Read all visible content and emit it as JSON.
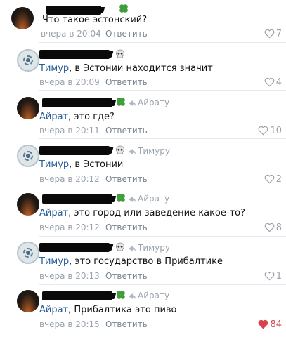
{
  "comments": [
    {
      "avatar": "sunset-avatar",
      "avatar_style": "photo",
      "name_icon": "clover-icon",
      "reply_to": "",
      "mention": "",
      "text": "Что такое эстонский?",
      "time": "вчера в 20:04",
      "reply_label": "Ответить",
      "likes": "7",
      "liked": false
    },
    {
      "avatar": "badge-avatar",
      "avatar_style": "badge",
      "name_icon": "skull-icon",
      "reply_to": "",
      "mention": "Тимур",
      "text": ", в Эстонии находится значит",
      "time": "вчера в 20:09",
      "reply_label": "Ответить",
      "likes": "4",
      "liked": false
    },
    {
      "avatar": "sunset-avatar",
      "avatar_style": "photo",
      "name_icon": "clover-icon",
      "reply_to": "Айрату",
      "mention": "Айрат",
      "text": ", это где?",
      "time": "вчера в 20:11",
      "reply_label": "Ответить",
      "likes": "10",
      "liked": false
    },
    {
      "avatar": "badge-avatar",
      "avatar_style": "badge",
      "name_icon": "skull-icon",
      "reply_to": "Тимуру",
      "mention": "Тимур",
      "text": ", в Эстонии",
      "time": "вчера в 20:12",
      "reply_label": "Ответить",
      "likes": "2",
      "liked": false
    },
    {
      "avatar": "sunset-avatar",
      "avatar_style": "photo",
      "name_icon": "clover-icon",
      "reply_to": "Айрату",
      "mention": "Айрат",
      "text": ", это город или заведение какое-то?",
      "time": "вчера в 20:12",
      "reply_label": "Ответить",
      "likes": "8",
      "liked": false
    },
    {
      "avatar": "badge-avatar",
      "avatar_style": "badge",
      "name_icon": "skull-icon",
      "reply_to": "Тимуру",
      "mention": "Тимур",
      "text": ", это государство в Прибалтике",
      "time": "вчера в 20:13",
      "reply_label": "Ответить",
      "likes": "1",
      "liked": false
    },
    {
      "avatar": "sunset-avatar",
      "avatar_style": "photo",
      "name_icon": "clover-icon",
      "reply_to": "Айрату",
      "mention": "Айрат",
      "text": ", Прибалтика это пиво",
      "time": "вчера в 20:15",
      "reply_label": "Ответить",
      "likes": "84",
      "liked": true
    }
  ],
  "colors": {
    "mention": "#2a5f97",
    "meta": "#9aa3ad",
    "like_active": "#d8434e",
    "clover": "#3f9e3a"
  }
}
